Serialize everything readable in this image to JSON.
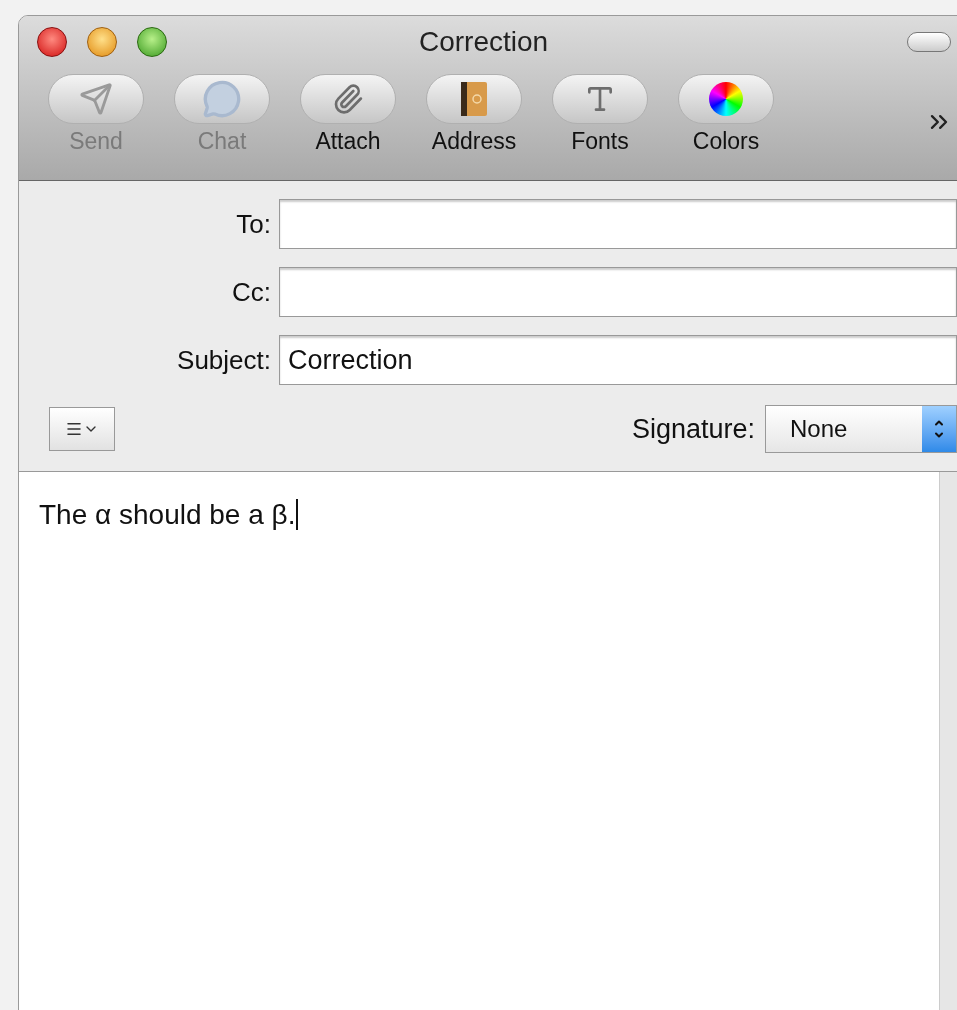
{
  "window": {
    "title": "Correction"
  },
  "toolbar": [
    {
      "label": "Send",
      "kind": "send",
      "disabled": true
    },
    {
      "label": "Chat",
      "kind": "chat",
      "disabled": true
    },
    {
      "label": "Attach",
      "kind": "attach",
      "disabled": false
    },
    {
      "label": "Address",
      "kind": "address",
      "disabled": false
    },
    {
      "label": "Fonts",
      "kind": "fonts",
      "disabled": false
    },
    {
      "label": "Colors",
      "kind": "colors",
      "disabled": false
    }
  ],
  "fields": [
    {
      "label": "To:"
    },
    {
      "label": "Cc:"
    },
    {
      "label": "Subject:",
      "value": "Correction"
    }
  ],
  "signature": {
    "label": "Signature:",
    "value": "None"
  },
  "body": {
    "text": "The α should be a β."
  }
}
